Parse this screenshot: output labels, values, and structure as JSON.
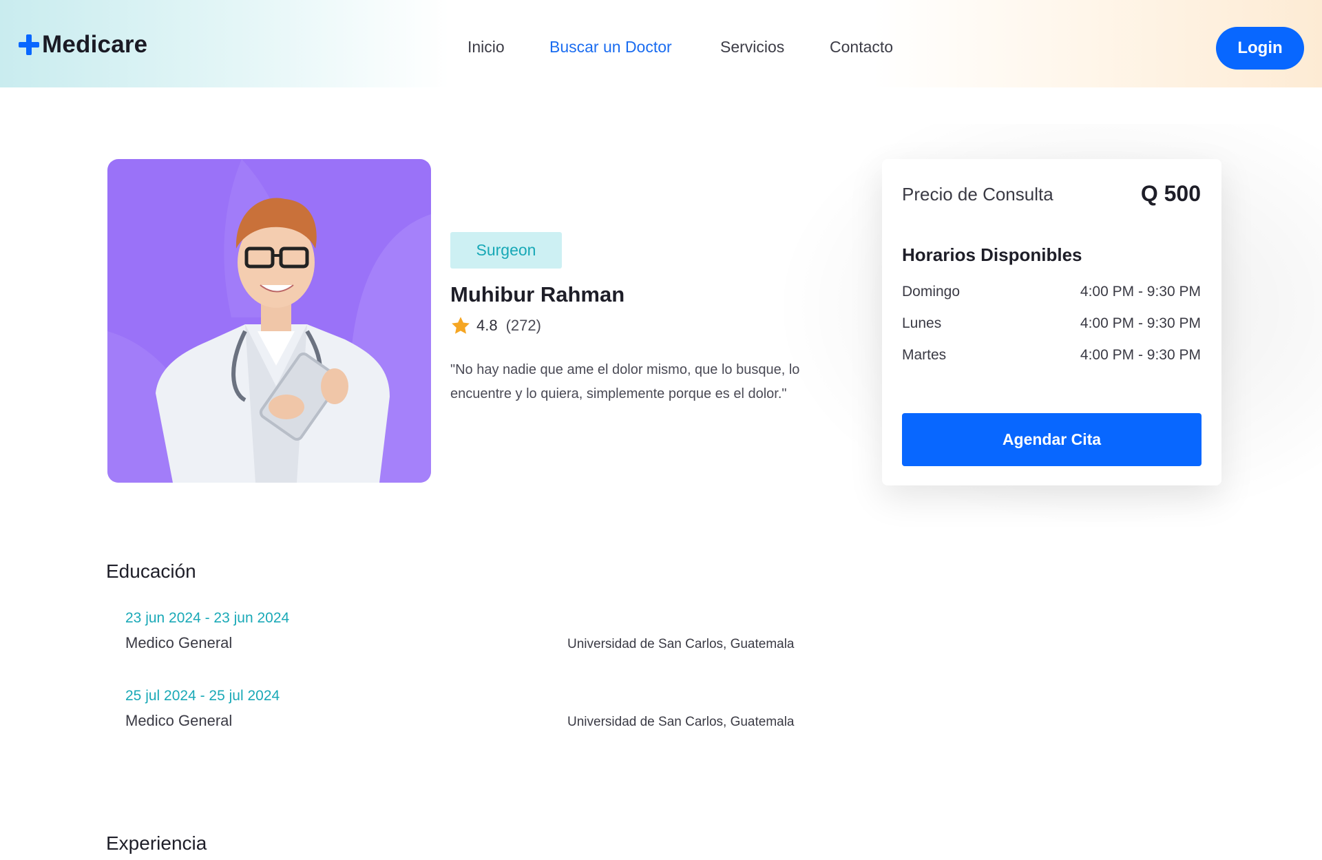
{
  "header": {
    "logo_text": "Medicare",
    "nav": [
      {
        "label": "Inicio",
        "active": false
      },
      {
        "label": "Buscar un Doctor",
        "active": true
      },
      {
        "label": "Servicios",
        "active": false
      },
      {
        "label": "Contacto",
        "active": false
      }
    ],
    "login_label": "Login"
  },
  "doctor": {
    "specialty": "Surgeon",
    "name": "Muhibur Rahman",
    "rating": "4.8",
    "reviews": "(272)",
    "bio": "\"No hay nadie que ame el dolor mismo, que lo busque, lo encuentre y lo quiera, simplemente porque es el dolor.\""
  },
  "booking": {
    "price_label": "Precio de Consulta",
    "price_value": "Q 500",
    "schedule_title": "Horarios Disponibles",
    "schedule": [
      {
        "day": "Domingo",
        "time": "4:00 PM - 9:30 PM"
      },
      {
        "day": "Lunes",
        "time": "4:00 PM - 9:30 PM"
      },
      {
        "day": "Martes",
        "time": "4:00 PM - 9:30 PM"
      }
    ],
    "book_label": "Agendar Cita"
  },
  "education": {
    "title": "Educación",
    "items": [
      {
        "dates": "23 jun 2024 - 23 jun 2024",
        "degree": "Medico General",
        "institution": "Universidad de San Carlos, Guatemala"
      },
      {
        "dates": "25 jul 2024 - 25 jul 2024",
        "degree": "Medico General",
        "institution": "Universidad de San Carlos, Guatemala"
      }
    ]
  },
  "experience": {
    "title": "Experiencia"
  },
  "colors": {
    "accent": "#0867ff",
    "teal": "#1aa9b7",
    "photo_bg": "#9a72f8",
    "star": "#f5a623"
  },
  "icons": {
    "logo": "plus-icon",
    "rating": "star-icon"
  }
}
